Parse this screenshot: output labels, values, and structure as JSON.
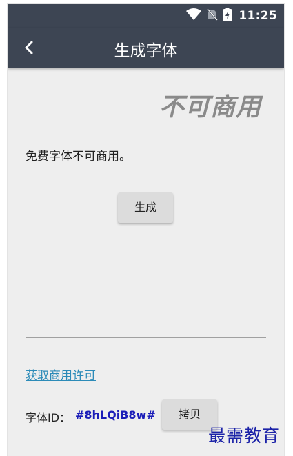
{
  "status_bar": {
    "time": "11:25",
    "icons": [
      "wifi-icon",
      "no-sim-icon",
      "battery-charging-icon"
    ]
  },
  "app_bar": {
    "title": "生成字体",
    "back_icon": "back-arrow-icon"
  },
  "preview_text": "不可商用",
  "description": "免费字体不可商用。",
  "generate_button": "生成",
  "license_link": "获取商用许可",
  "font_id": {
    "label": "字体ID：",
    "value": "#8hLQiB8w#"
  },
  "copy_button": "拷贝",
  "watermark": "最需教育",
  "colors": {
    "app_bar": "#3d4553",
    "background": "#eeeeee",
    "link": "#2c8bb8",
    "font_id_value": "#1b1db8"
  }
}
